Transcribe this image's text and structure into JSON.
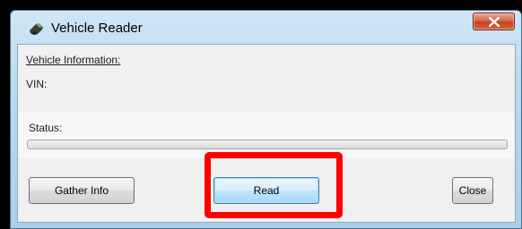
{
  "window": {
    "title": "Vehicle Reader",
    "app_icon": "vehicle-reader-app-icon",
    "close_icon": "close-x-icon"
  },
  "content": {
    "section_heading": "Vehicle Information:",
    "vin_label": "VIN:",
    "status_label": "Status:",
    "progress": 0
  },
  "buttons": {
    "gather_info": "Gather Info",
    "read": "Read",
    "close": "Close"
  },
  "annotation": {
    "highlight_color": "#ff0000",
    "highlight_target": "Read"
  },
  "colors": {
    "titlebar": "#b9d9ef",
    "close_button": "#c7401f",
    "client_bg": "#f0f0f0"
  }
}
